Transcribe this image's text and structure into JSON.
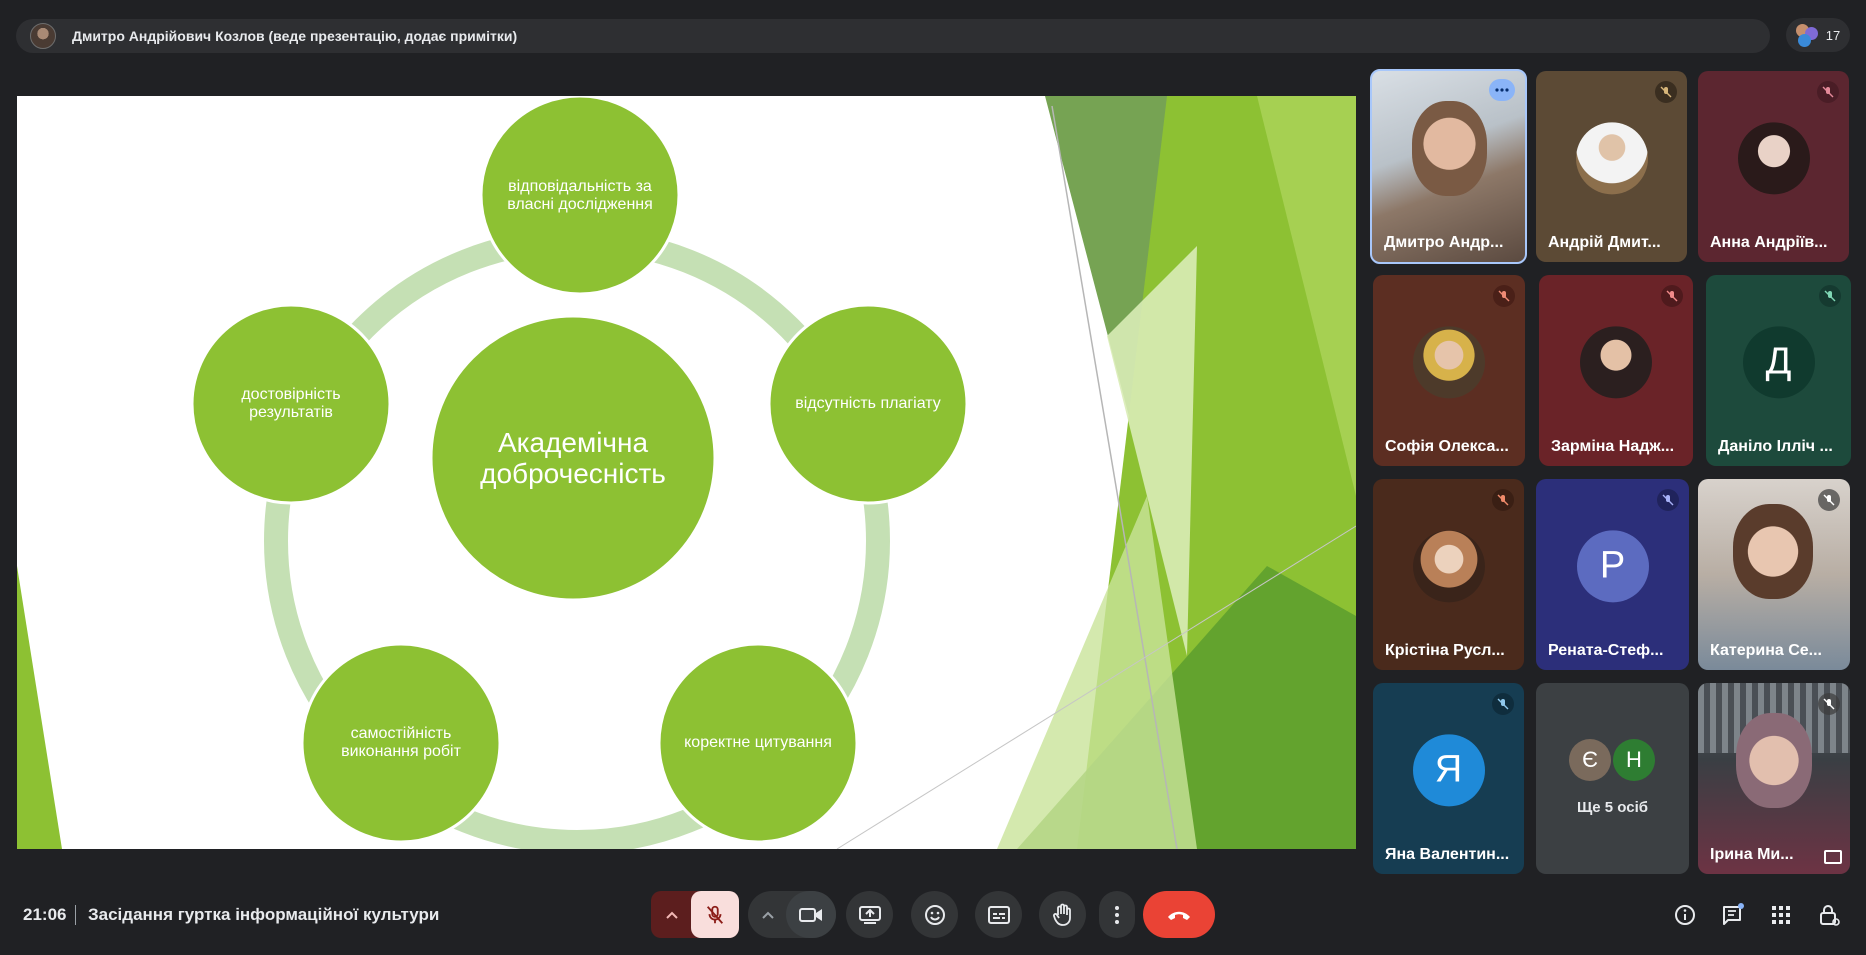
{
  "header": {
    "presenter_text": "Дмитро Андрійович Козлов (веде презентацію, додає примітки)",
    "participant_count": "17"
  },
  "slide": {
    "center": "Академічна доброчесність",
    "items": [
      "відповідальність за власні дослідження",
      "відсутність плагіату",
      "коректне цитування",
      "самостійність виконання робіт",
      "достовірність результатів"
    ]
  },
  "tiles": [
    {
      "name": "Дмитро Андр...",
      "kind": "video",
      "active": true
    },
    {
      "name": "Андрій Дмит...",
      "kind": "photo",
      "muted": true
    },
    {
      "name": "Анна Андріїв...",
      "kind": "photo",
      "muted": true
    },
    {
      "name": "Софія Олекса...",
      "kind": "photo",
      "muted": true
    },
    {
      "name": "Зарміна Надж...",
      "kind": "photo",
      "muted": true
    },
    {
      "name": "Даніло Ілліч ...",
      "kind": "letter",
      "letter": "Д",
      "muted": true
    },
    {
      "name": "Крістіна Русл...",
      "kind": "photo",
      "muted": true
    },
    {
      "name": "Рената-Стеф...",
      "kind": "letter",
      "letter": "Р",
      "muted": true
    },
    {
      "name": "Катерина Се...",
      "kind": "video",
      "muted": true
    },
    {
      "name": "Яна Валентин...",
      "kind": "letter",
      "letter": "Я",
      "muted": true
    },
    {
      "name": "Ще 5 осіб",
      "kind": "more",
      "letters": [
        "Є",
        "Н"
      ]
    },
    {
      "name": "Ірина Ми...",
      "kind": "video",
      "muted": true
    }
  ],
  "footer": {
    "time": "21:06",
    "meeting_title": "Засідання гуртка інформаційної культури"
  },
  "colors": {
    "background": "#202124",
    "circle_green": "#8dc133",
    "ring_green": "#c5e0b4",
    "end_call": "#ea4335",
    "mic_off_bg": "#f9dedc"
  },
  "icons": {
    "mic": "mic-off-icon",
    "camera": "camera-icon",
    "present": "present-icon",
    "emoji": "emoji-icon",
    "captions": "captions-icon",
    "hand": "raise-hand-icon",
    "more": "more-options-icon",
    "end": "end-call-icon",
    "info": "info-icon",
    "chat": "chat-icon",
    "apps": "apps-icon",
    "lock": "host-controls-icon"
  }
}
